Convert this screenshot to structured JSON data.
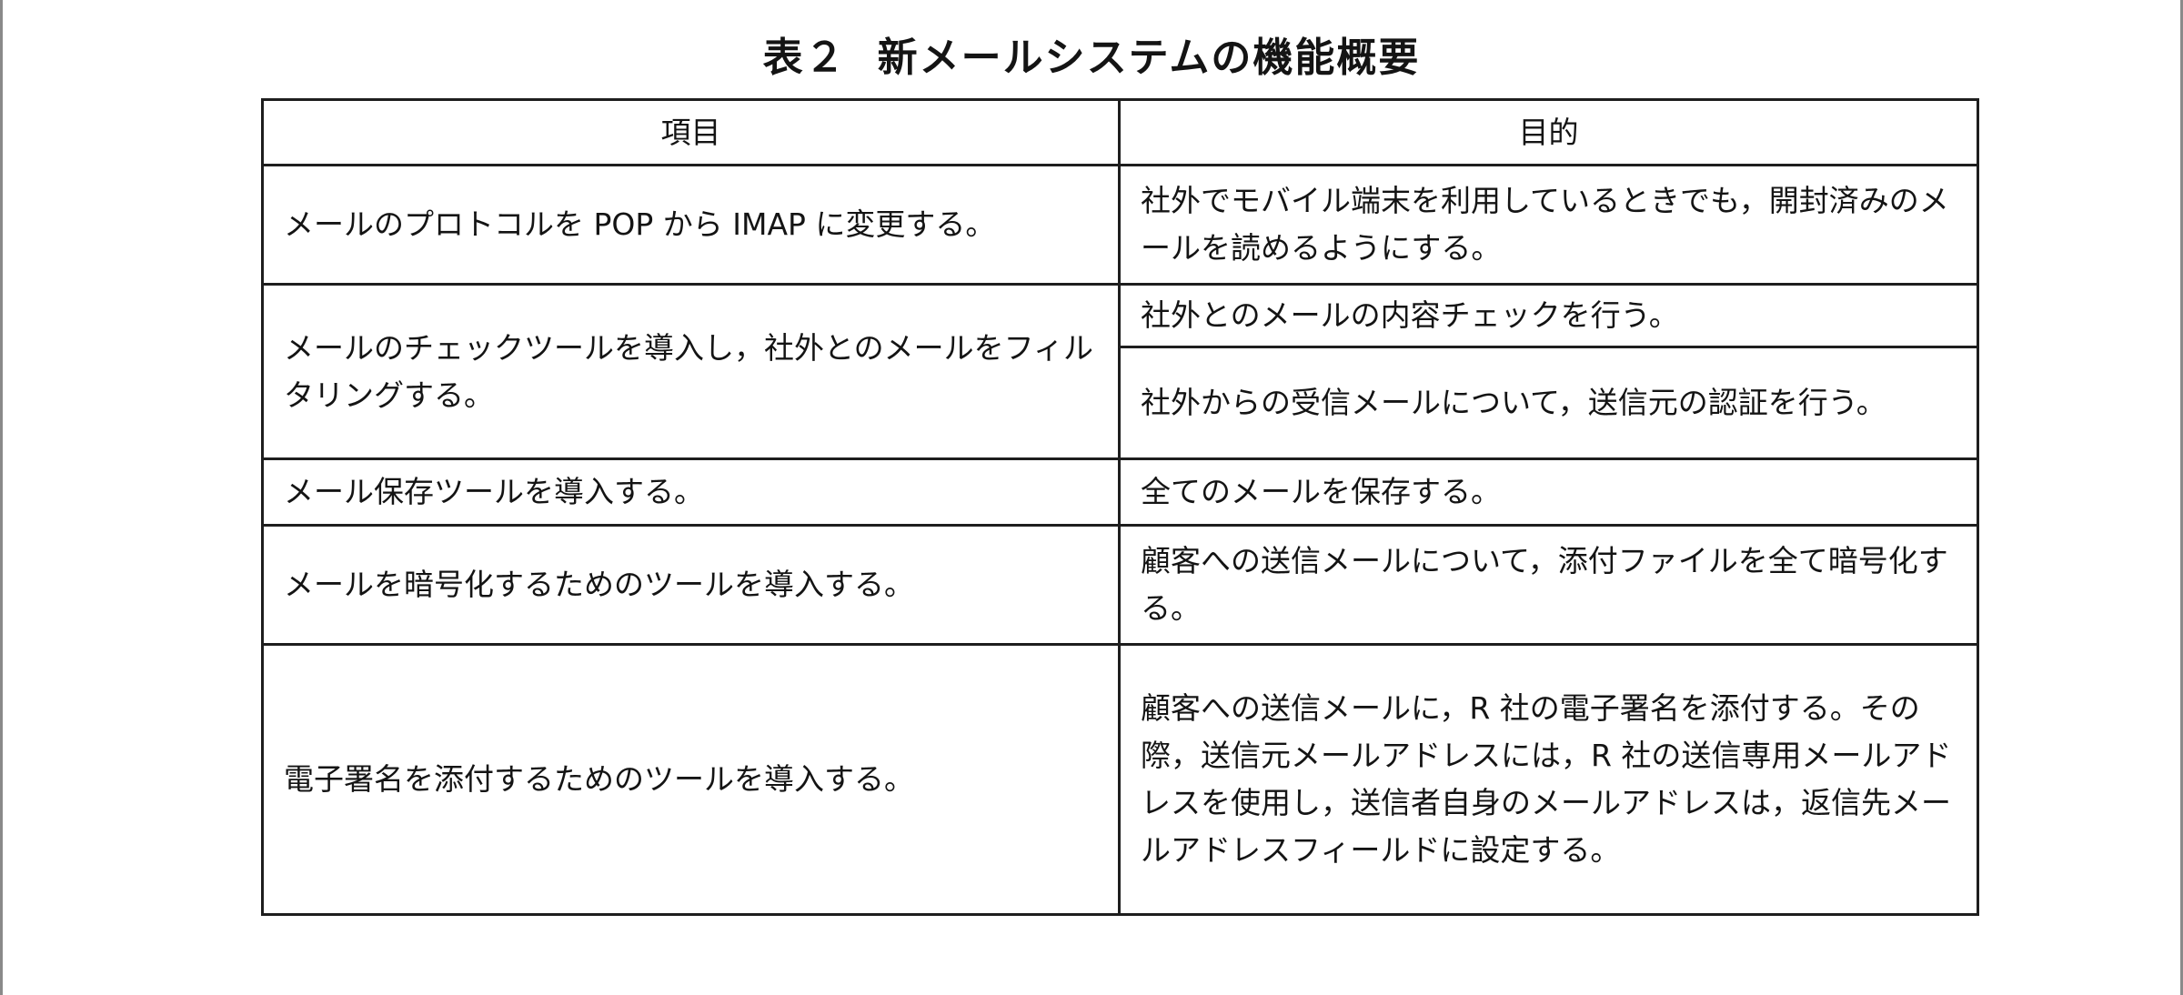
{
  "title": {
    "number": "表２",
    "text": "新メールシステムの機能概要"
  },
  "table": {
    "headers": [
      "項目",
      "目的"
    ],
    "rows": [
      {
        "item": "メールのプロトコルを POP から IMAP に変更する。",
        "purposes": [
          "社外でモバイル端末を利用しているときでも，開封済みのメールを読めるようにする。"
        ]
      },
      {
        "item": "メールのチェックツールを導入し，社外とのメールをフィルタリングする。",
        "purposes": [
          "社外とのメールの内容チェックを行う。",
          "社外からの受信メールについて，送信元の認証を行う。"
        ]
      },
      {
        "item": "メール保存ツールを導入する。",
        "purposes": [
          "全てのメールを保存する。"
        ]
      },
      {
        "item": "メールを暗号化するためのツールを導入する。",
        "purposes": [
          "顧客への送信メールについて，添付ファイルを全て暗号化する。"
        ]
      },
      {
        "item": "電子署名を添付するためのツールを導入する。",
        "purposes": [
          "顧客への送信メールに，R 社の電子署名を添付する。その際，送信元メールアドレスには，R 社の送信専用メールアドレスを使用し，送信者自身のメールアドレスは，返信先メールアドレスフィールドに設定する。"
        ]
      }
    ]
  }
}
